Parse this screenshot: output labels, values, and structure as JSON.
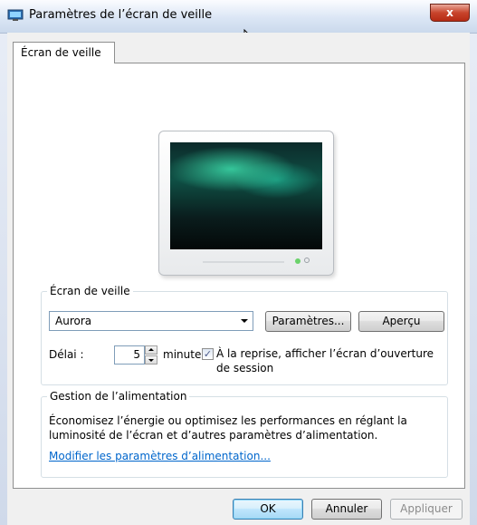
{
  "window": {
    "title": "Paramètres de l’écran de veille",
    "close_label": "x"
  },
  "tabs": [
    {
      "label": "Écran de veille",
      "selected": true
    }
  ],
  "screensaver": {
    "group_label": "Écran de veille",
    "selected": "Aurora",
    "settings_button": "Paramètres...",
    "preview_button": "Aperçu",
    "delay_label": "Délai :",
    "delay_value": "5",
    "delay_unit": "minutes",
    "resume_checked": true,
    "resume_label_line1": "À la reprise, afficher l’écran d’ouverture",
    "resume_label_line2": "de session"
  },
  "power": {
    "group_label": "Gestion de l’alimentation",
    "description_line1": "Économisez l’énergie ou optimisez les performances en réglant la",
    "description_line2": "luminosité de l’écran et d’autres paramètres d’alimentation.",
    "link": "Modifier les paramètres d’alimentation..."
  },
  "footer": {
    "ok": "OK",
    "cancel": "Annuler",
    "apply": "Appliquer"
  },
  "colors": {
    "link": "#0066cc",
    "close_button": "#c8442c"
  }
}
